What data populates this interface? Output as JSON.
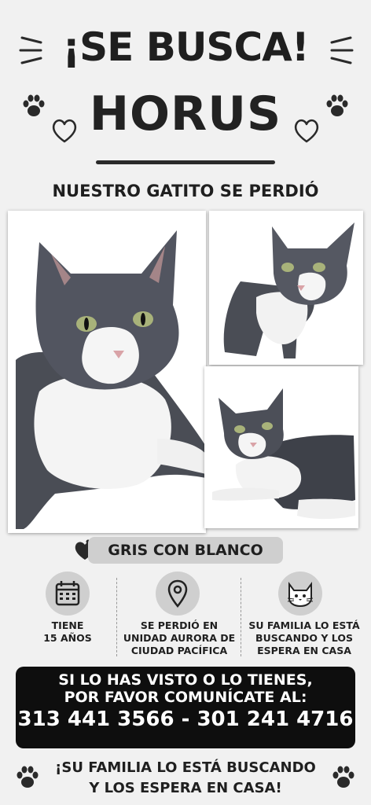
{
  "header": {
    "title": "¡SE BUSCA!",
    "name": "HORUS",
    "subtitle": "NUESTRO GATITO SE PERDIÓ"
  },
  "color_badge": {
    "label": "GRIS CON BLANCO"
  },
  "info": [
    {
      "icon": "calendar-icon",
      "text_line1": "TIENE",
      "text_line2": "15 AÑOS"
    },
    {
      "icon": "location-pin-icon",
      "text_line1": "SE PERDIÓ EN",
      "text_line2": "UNIDAD AURORA DE",
      "text_line3": "CIUDAD PACÍFICA"
    },
    {
      "icon": "cat-face-icon",
      "text_line1": "SU FAMILIA LO ESTÁ",
      "text_line2": "BUSCANDO Y LOS",
      "text_line3": "ESPERA EN CASA"
    }
  ],
  "contact": {
    "line1": "SI LO HAS VISTO O LO TIENES,",
    "line2": "POR FAVOR COMUNÍCATE AL:",
    "phones": "313 441 3566 - 301 241 4716"
  },
  "footer": {
    "line1": "¡SU FAMILIA LO ESTÁ BUSCANDO",
    "line2": "Y LOS ESPERA EN CASA!"
  },
  "colors": {
    "background": "#f1f1f1",
    "text": "#1f1f1f",
    "badge": "#cfcfcf",
    "contact_box": "#0e0e0e"
  }
}
